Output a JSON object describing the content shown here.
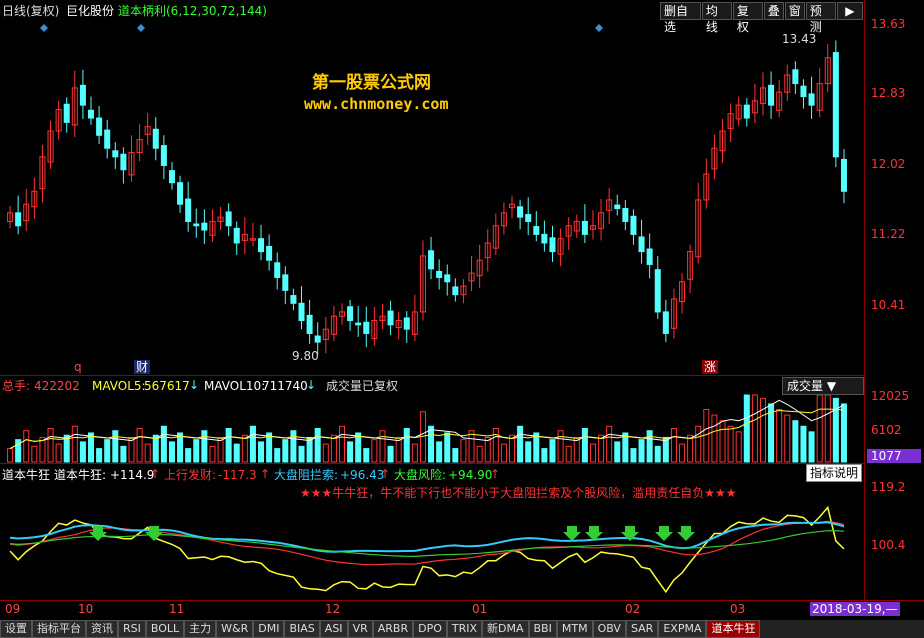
{
  "header": {
    "period": "日线(复权)",
    "stock": "巨化股份",
    "indicator": "道本柄利(6,12,30,72,144)"
  },
  "toolbar": {
    "buttons": [
      "删自选",
      "均线",
      "复权",
      "叠",
      "窗",
      "预测"
    ],
    "menu_arrow": "▶"
  },
  "watermark": {
    "title": "第一股票公式网",
    "url": "www.chnmoney.com"
  },
  "price_axis": [
    "13.63",
    "12.83",
    "12.02",
    "11.22",
    "10.41"
  ],
  "price_notes": {
    "high": "13.43",
    "low": "9.80",
    "marks": [
      "q",
      "财",
      "涨"
    ]
  },
  "volume": {
    "total_label": "总手:",
    "total_value": "422202",
    "mavol5_label": "MAVOL5:",
    "mavol5_value": "567617",
    "mavol10_label": "MAVOL10:",
    "mavol10_value": "711740",
    "note": "成交量已复权",
    "selector": "成交量",
    "axis": [
      "12025",
      "6102",
      "1077"
    ]
  },
  "indicator_panel": {
    "name": "道本牛狂",
    "v1_label": "道本牛狂:",
    "v1_value": "+114.9",
    "v2_label": "上行发财:",
    "v2_value": "-117.3",
    "v3_label": "大盘阻拦索:",
    "v3_value": "+96.43",
    "v4_label": "大盘风险:",
    "v4_value": "+94.90",
    "banner": "★★★牛牛狂，牛不能下行也不能小于大盘阻拦索及个股风险，滥用责任自负★★★",
    "help_button": "指标说明",
    "axis": [
      "119.2",
      "100.4"
    ]
  },
  "x_axis": {
    "labels": [
      "09",
      "10",
      "11",
      "12",
      "01",
      "02",
      "03"
    ],
    "date_badge": "2018-03-19,—"
  },
  "tabs": [
    "设置",
    "指标平台",
    "资讯",
    "RSI",
    "BOLL",
    "主力",
    "W&R",
    "DMI",
    "BIAS",
    "ASI",
    "VR",
    "ARBR",
    "DPO",
    "TRIX",
    "新DMA",
    "BBI",
    "MTM",
    "OBV",
    "SAR",
    "EXPMA",
    "道本牛狂"
  ],
  "colors": {
    "up": "#ff3333",
    "down": "#54ffff",
    "frame": "#8b0000",
    "yellow": "#ffff33",
    "green": "#33cc33",
    "cyan": "#33ccff"
  },
  "chart_data": {
    "type": "line",
    "ylim": [
      9.8,
      13.63
    ],
    "close": [
      11.45,
      11.3,
      11.55,
      11.7,
      12.1,
      12.4,
      12.65,
      12.5,
      12.9,
      12.7,
      12.55,
      12.35,
      12.2,
      12.1,
      11.95,
      12.15,
      12.3,
      12.45,
      12.2,
      12.0,
      11.8,
      11.55,
      11.35,
      11.3,
      11.25,
      11.35,
      11.4,
      11.3,
      11.1,
      11.2,
      11.15,
      11.0,
      10.9,
      10.7,
      10.55,
      10.4,
      10.2,
      10.05,
      9.95,
      10.1,
      10.25,
      10.3,
      10.2,
      10.15,
      10.05,
      10.2,
      10.25,
      10.15,
      10.2,
      10.1,
      10.3,
      10.95,
      10.8,
      10.7,
      10.65,
      10.5,
      10.6,
      10.75,
      10.9,
      11.1,
      11.3,
      11.45,
      11.55,
      11.4,
      11.35,
      11.2,
      11.1,
      11.0,
      11.15,
      11.3,
      11.35,
      11.2,
      11.3,
      11.45,
      11.6,
      11.5,
      11.35,
      11.2,
      11.0,
      10.85,
      10.3,
      10.05,
      10.45,
      10.65,
      11.0,
      11.6,
      11.9,
      12.2,
      12.4,
      12.6,
      12.7,
      12.55,
      12.75,
      12.9,
      12.7,
      12.85,
      13.05,
      12.95,
      12.8,
      12.7,
      12.95,
      13.25,
      12.1,
      11.7
    ]
  }
}
